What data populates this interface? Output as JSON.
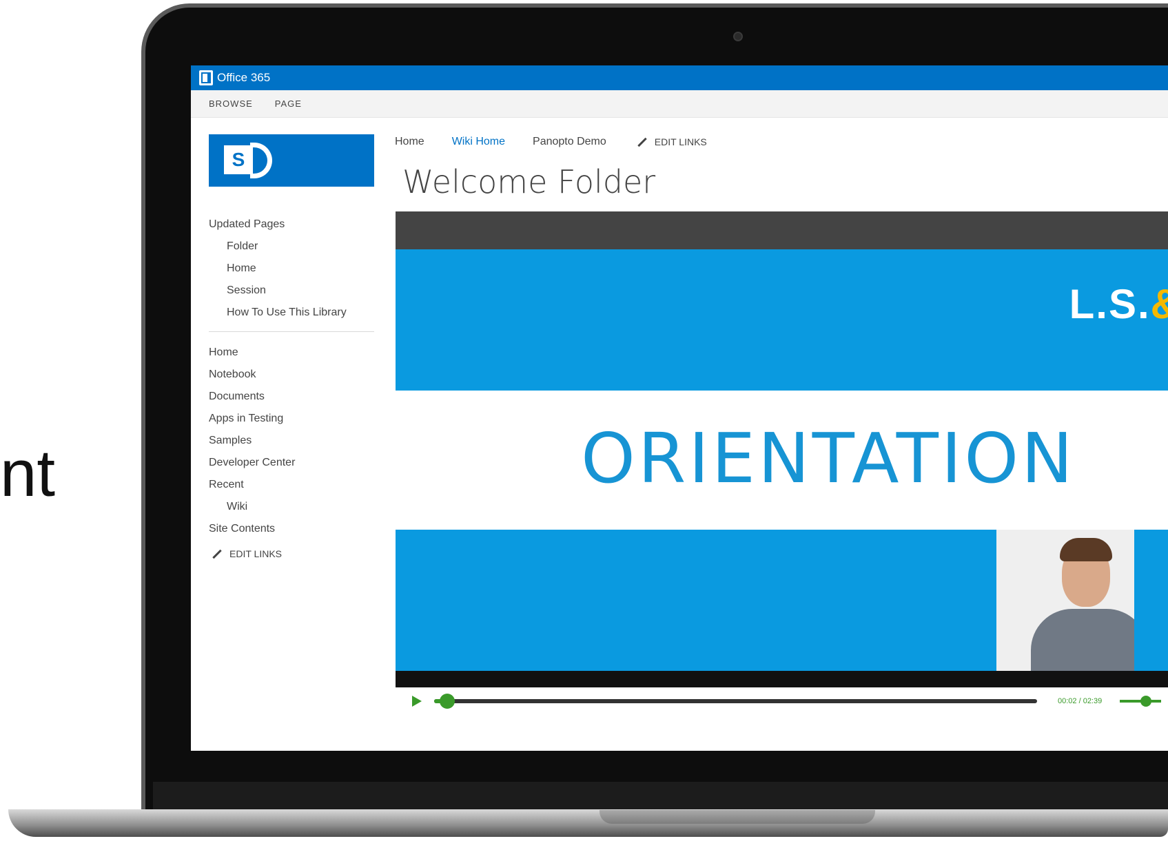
{
  "side_text": "nt",
  "o365": {
    "title": "Office 365"
  },
  "ribbon": {
    "tabs": [
      "BROWSE",
      "PAGE"
    ]
  },
  "breadcrumb": {
    "items": [
      "Home",
      "Wiki Home",
      "Panopto Demo"
    ],
    "edit_links": "EDIT LINKS"
  },
  "page": {
    "title": "Welcome Folder"
  },
  "leftnav": {
    "updated_pages": "Updated Pages",
    "updated_items": [
      "Folder",
      "Home",
      "Session",
      "How To Use This Library"
    ],
    "items": [
      "Home",
      "Notebook",
      "Documents",
      "Apps in Testing",
      "Samples",
      "Developer Center",
      "Recent"
    ],
    "recent_sub": "Wiki",
    "site_contents": "Site Contents",
    "edit_links": "EDIT LINKS"
  },
  "video": {
    "brand_text": "L.S.",
    "brand_amp": "&",
    "slide_title": "ORIENTATION",
    "time": "00:02 / 02:39",
    "progress_fraction": 0.02
  },
  "colors": {
    "o365_blue": "#0072c6",
    "slide_blue": "#0a9ae0",
    "player_green": "#3a9a2a",
    "amp_yellow": "#f5b800"
  }
}
